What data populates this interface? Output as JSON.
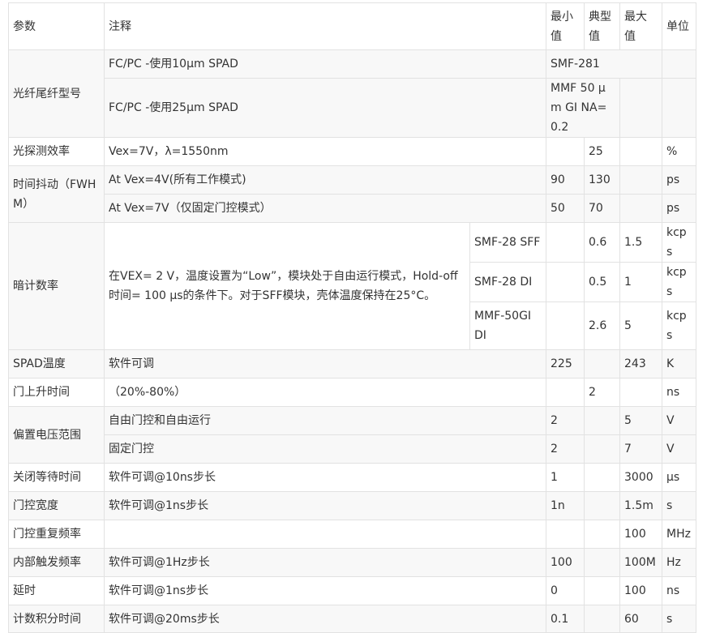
{
  "table": {
    "header": {
      "param": "参数",
      "note": "注释",
      "min": "最小值",
      "typ": "典型值",
      "max": "最大值",
      "unit": "单位"
    },
    "fiber": {
      "param": "光纤尾纤型号",
      "r1": {
        "note": "FC/PC -使用10μm SPAD",
        "value": "SMF-281"
      },
      "r2": {
        "note": "FC/PC -使用25μm SPAD",
        "value": "MMF 50 μm GI NA=0.2"
      }
    },
    "efficiency": {
      "param": "光探测效率",
      "note": "Vex=7V，λ=1550nm",
      "min": "",
      "typ": "25",
      "max": "",
      "unit": "%"
    },
    "jitter": {
      "param": "时间抖动（FWHM）",
      "r1": {
        "note": "At Vex=4V(所有工作模式)",
        "min": "90",
        "typ": "130",
        "max": "",
        "unit": "ps"
      },
      "r2": {
        "note": "At Vex=7V（仅固定门控模式）",
        "min": "50",
        "typ": "70",
        "max": "",
        "unit": "ps"
      }
    },
    "dark": {
      "param": "暗计数率",
      "note": "在VEX= 2 V，温度设置为“Low”，模块处于自由运行模式，Hold-off 时间= 100 μs的条件下。对于SFF模块，壳体温度保持在25°C。",
      "r1": {
        "fiber": "SMF-28 SFF",
        "min": "",
        "typ": "0.6",
        "max": "1.5",
        "unit": "kcps"
      },
      "r2": {
        "fiber": "SMF-28 DI",
        "min": "",
        "typ": "0.5",
        "max": "1",
        "unit": "kcps"
      },
      "r3": {
        "fiber": "MMF-50GI DI",
        "min": "",
        "typ": "2.6",
        "max": "5",
        "unit": "kcps"
      }
    },
    "spad_temp": {
      "param": "SPAD温度",
      "note": "软件可调",
      "min": "225",
      "typ": "",
      "max": "243",
      "unit": "K"
    },
    "gate_rise": {
      "param": "门上升时间",
      "note": "（20%-80%）",
      "min": "",
      "typ": "2",
      "max": "",
      "unit": "ns"
    },
    "bias": {
      "param": "偏置电压范围",
      "r1": {
        "note": "自由门控和自由运行",
        "min": "2",
        "typ": "",
        "max": "5",
        "unit": "V"
      },
      "r2": {
        "note": "固定门控",
        "min": "2",
        "typ": "",
        "max": "7",
        "unit": "V"
      }
    },
    "holdoff": {
      "param": "关闭等待时间",
      "note": "软件可调@10ns步长",
      "min": "1",
      "typ": "",
      "max": "3000",
      "unit": "μs"
    },
    "gate_width": {
      "param": "门控宽度",
      "note": "软件可调@1ns步长",
      "min": "1n",
      "typ": "",
      "max": "1.5m",
      "unit": "s"
    },
    "gate_rep": {
      "param": "门控重复频率",
      "note": "",
      "min": "",
      "typ": "",
      "max": "100",
      "unit": "MHz"
    },
    "trigger": {
      "param": "内部触发频率",
      "note": "软件可调@1Hz步长",
      "min": "100",
      "typ": "",
      "max": "100M",
      "unit": "Hz"
    },
    "delay": {
      "param": "延时",
      "note": "软件可调@1ns步长",
      "min": "0",
      "typ": "",
      "max": "100",
      "unit": "ns"
    },
    "integration": {
      "param": "计数积分时间",
      "note": "软件可调@20ms步长",
      "min": "0.1",
      "typ": "",
      "max": "60",
      "unit": "s"
    }
  }
}
